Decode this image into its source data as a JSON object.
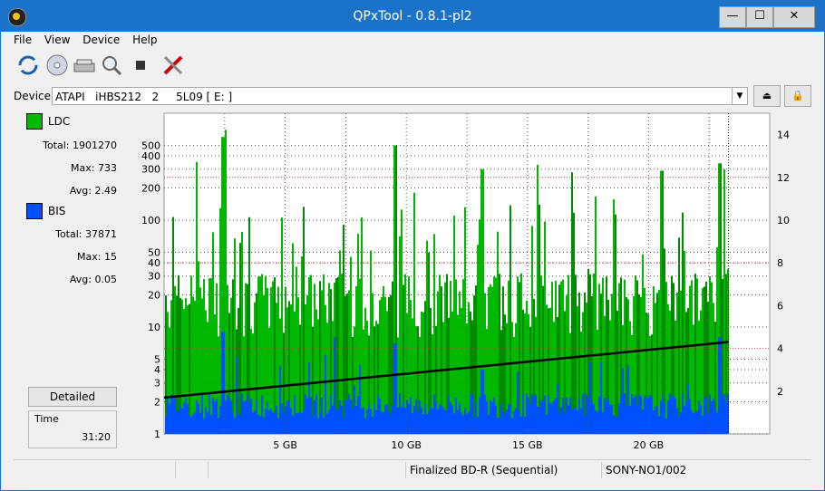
{
  "window": {
    "title": "QPxTool - 0.8.1-pl2",
    "controls": {
      "minimize": "—",
      "maximize": "☐",
      "close": "✕"
    }
  },
  "menu": [
    "File",
    "View",
    "Device",
    "Help"
  ],
  "toolbar": {
    "icons": [
      "refresh-icon",
      "disc-info-icon",
      "drive-icon",
      "scan-icon",
      "stop-icon",
      "settings-tools-icon"
    ]
  },
  "device": {
    "label": "Device:",
    "selected": "ATAPI   iHBS212   2     5L09 [ E: ]",
    "eject_icon": "eject-icon",
    "lock_icon": "lock-icon"
  },
  "legend": {
    "ldc": {
      "name": "LDC",
      "color": "#00b800",
      "total_label": "Total:",
      "total": "1901270",
      "max_label": "Max:",
      "max": "733",
      "avg_label": "Avg:",
      "avg": "2.49"
    },
    "bis": {
      "name": "BIS",
      "color": "#0050ff",
      "total_label": "Total:",
      "total": "37871",
      "max_label": "Max:",
      "max": "15",
      "avg_label": "Avg:",
      "avg": "0.05"
    }
  },
  "detailed_button": "Detailed",
  "time": {
    "label": "Time",
    "value": "31:20"
  },
  "chart_data": {
    "type": "bar",
    "x_unit": "GB",
    "xlim": [
      0,
      25
    ],
    "x_ticks": [
      5,
      10,
      15,
      20
    ],
    "x_tick_labels": [
      "5 GB",
      "10 GB",
      "15 GB",
      "20 GB"
    ],
    "y_left_scale": "log",
    "y_left_ticks": [
      1,
      2,
      3,
      4,
      5,
      10,
      20,
      30,
      40,
      50,
      100,
      200,
      300,
      400,
      500
    ],
    "ylim_left": [
      1,
      1000
    ],
    "y_right_ticks": [
      2,
      4,
      6,
      8,
      10,
      12,
      14
    ],
    "ylim_right": [
      0,
      15
    ],
    "grid": true,
    "data_end_gb": 23.3,
    "series": [
      {
        "name": "LDC",
        "color": "#00b800",
        "approx_baseline": 20,
        "peaks": [
          [
            1.3,
            350
          ],
          [
            2.4,
            600
          ],
          [
            2.5,
            700
          ],
          [
            9.5,
            500
          ],
          [
            10.3,
            180
          ],
          [
            13.1,
            300
          ],
          [
            15.4,
            330
          ],
          [
            16.8,
            280
          ],
          [
            20.5,
            290
          ],
          [
            22.9,
            340
          ],
          [
            23.1,
            300
          ]
        ]
      },
      {
        "name": "BIS",
        "color": "#0050ff",
        "approx_baseline": 2,
        "peaks": [
          [
            2.4,
            9
          ],
          [
            7.0,
            8
          ],
          [
            9.5,
            7
          ],
          [
            13.1,
            4
          ],
          [
            22.9,
            8
          ]
        ]
      },
      {
        "name": "Speed",
        "color": "#000000",
        "axis": "right",
        "points": [
          [
            0,
            1.7
          ],
          [
            23.3,
            4.3
          ]
        ]
      }
    ]
  },
  "statusbar": {
    "cells": [
      "",
      "",
      "Finalized BD-R (Sequential)",
      "SONY-NO1/002"
    ]
  }
}
